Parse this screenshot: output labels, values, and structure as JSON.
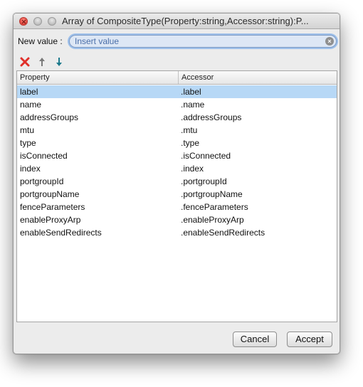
{
  "window": {
    "title": "Array of CompositeType(Property:string,Accessor:string):P..."
  },
  "new_value": {
    "label": "New value :",
    "placeholder": "Insert value",
    "value": ""
  },
  "toolbar": {
    "remove_icon": "red-x-icon",
    "up_icon": "arrow-up-icon",
    "down_icon": "arrow-down-icon"
  },
  "table": {
    "columns": [
      "Property",
      "Accessor"
    ],
    "rows": [
      {
        "property": "label",
        "accessor": ".label"
      },
      {
        "property": "name",
        "accessor": ".name"
      },
      {
        "property": "addressGroups",
        "accessor": ".addressGroups"
      },
      {
        "property": "mtu",
        "accessor": ".mtu"
      },
      {
        "property": "type",
        "accessor": ".type"
      },
      {
        "property": "isConnected",
        "accessor": ".isConnected"
      },
      {
        "property": "index",
        "accessor": ".index"
      },
      {
        "property": "portgroupId",
        "accessor": ".portgroupId"
      },
      {
        "property": "portgroupName",
        "accessor": ".portgroupName"
      },
      {
        "property": "fenceParameters",
        "accessor": ".fenceParameters"
      },
      {
        "property": "enableProxyArp",
        "accessor": ".enableProxyArp"
      },
      {
        "property": "enableSendRedirects",
        "accessor": ".enableSendRedirects"
      }
    ],
    "selected_index": 0
  },
  "buttons": {
    "cancel": "Cancel",
    "accept": "Accept"
  },
  "colors": {
    "selection": "#b7d8f6",
    "remove_red": "#e0302a",
    "arrow_up_gray": "#7a7a7a",
    "arrow_down_teal": "#1d7a8c"
  }
}
